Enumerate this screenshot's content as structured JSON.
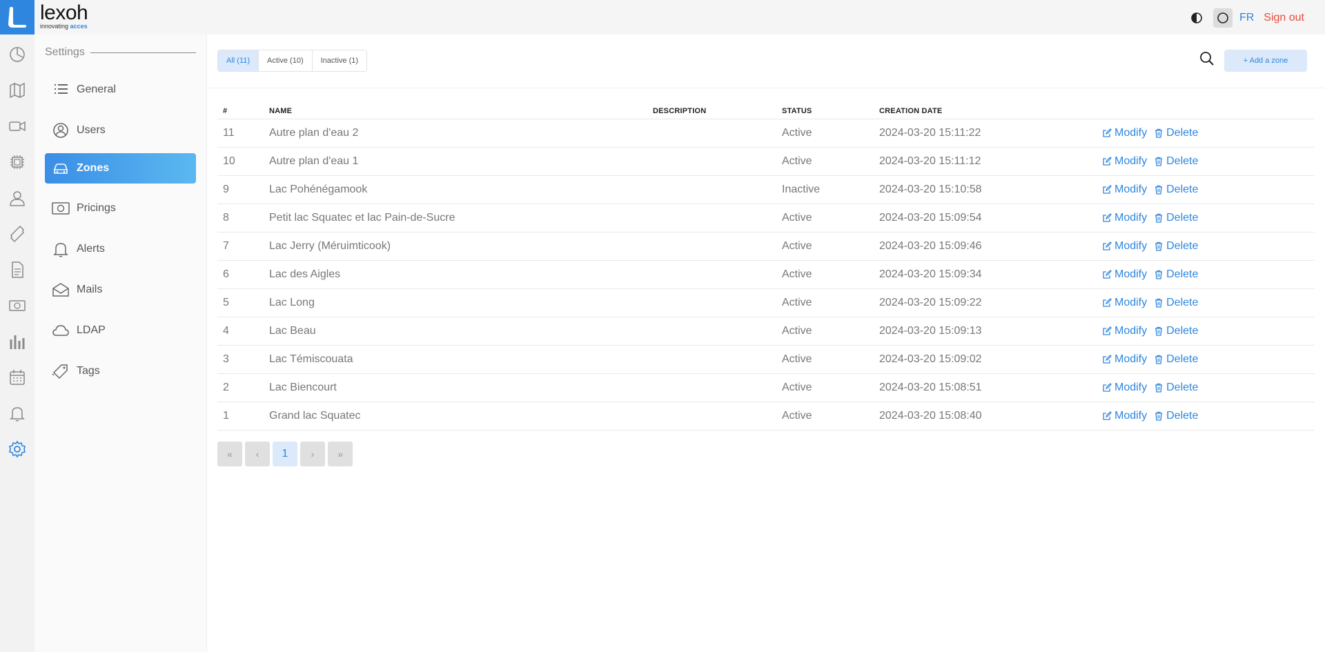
{
  "brand": {
    "name": "lexoh",
    "tagline_prefix": "innovating ",
    "tagline_accent": "acces"
  },
  "topbar": {
    "language": "FR",
    "signout": "Sign out"
  },
  "settings_title": "Settings",
  "sidebar": {
    "items": [
      {
        "label": "General",
        "icon": "list-icon"
      },
      {
        "label": "Users",
        "icon": "user-circle-icon"
      },
      {
        "label": "Zones",
        "icon": "car-icon",
        "active": true
      },
      {
        "label": "Pricings",
        "icon": "money-icon"
      },
      {
        "label": "Alerts",
        "icon": "bell-icon"
      },
      {
        "label": "Mails",
        "icon": "envelope-icon"
      },
      {
        "label": "LDAP",
        "icon": "cloud-icon"
      },
      {
        "label": "Tags",
        "icon": "tags-icon"
      }
    ]
  },
  "rail": [
    "dashboard-icon",
    "map-icon",
    "camera-icon",
    "chip-icon",
    "person-icon",
    "ticket-icon",
    "document-icon",
    "money-icon",
    "chart-icon",
    "calendar-icon",
    "bell-icon",
    "settings-icon"
  ],
  "filters": {
    "all": "All (11)",
    "active": "Active (10)",
    "inactive": "Inactive (1)"
  },
  "add_button": "+ Add a zone",
  "table": {
    "headers": {
      "num": "#",
      "name": "NAME",
      "description": "DESCRIPTION",
      "status": "STATUS",
      "date": "CREATION DATE"
    },
    "modify_label": "Modify",
    "delete_label": "Delete",
    "rows": [
      {
        "num": "11",
        "name": "Autre plan d'eau 2",
        "description": "",
        "status": "Active",
        "date": "2024-03-20 15:11:22"
      },
      {
        "num": "10",
        "name": "Autre plan d'eau 1",
        "description": "",
        "status": "Active",
        "date": "2024-03-20 15:11:12"
      },
      {
        "num": "9",
        "name": "Lac Pohénégamook",
        "description": "",
        "status": "Inactive",
        "date": "2024-03-20 15:10:58"
      },
      {
        "num": "8",
        "name": "Petit lac Squatec et lac Pain-de-Sucre",
        "description": "",
        "status": "Active",
        "date": "2024-03-20 15:09:54"
      },
      {
        "num": "7",
        "name": "Lac Jerry (Méruimticook)",
        "description": "",
        "status": "Active",
        "date": "2024-03-20 15:09:46"
      },
      {
        "num": "6",
        "name": "Lac des Aigles",
        "description": "",
        "status": "Active",
        "date": "2024-03-20 15:09:34"
      },
      {
        "num": "5",
        "name": "Lac Long",
        "description": "",
        "status": "Active",
        "date": "2024-03-20 15:09:22"
      },
      {
        "num": "4",
        "name": "Lac Beau",
        "description": "",
        "status": "Active",
        "date": "2024-03-20 15:09:13"
      },
      {
        "num": "3",
        "name": "Lac Témiscouata",
        "description": "",
        "status": "Active",
        "date": "2024-03-20 15:09:02"
      },
      {
        "num": "2",
        "name": "Lac Biencourt",
        "description": "",
        "status": "Active",
        "date": "2024-03-20 15:08:51"
      },
      {
        "num": "1",
        "name": "Grand lac Squatec",
        "description": "",
        "status": "Active",
        "date": "2024-03-20 15:08:40"
      }
    ]
  },
  "pagination": {
    "first": "«",
    "prev": "‹",
    "current": "1",
    "next": "›",
    "last": "»"
  },
  "colors": {
    "accent": "#2e86de",
    "danger": "#e74c3c"
  }
}
